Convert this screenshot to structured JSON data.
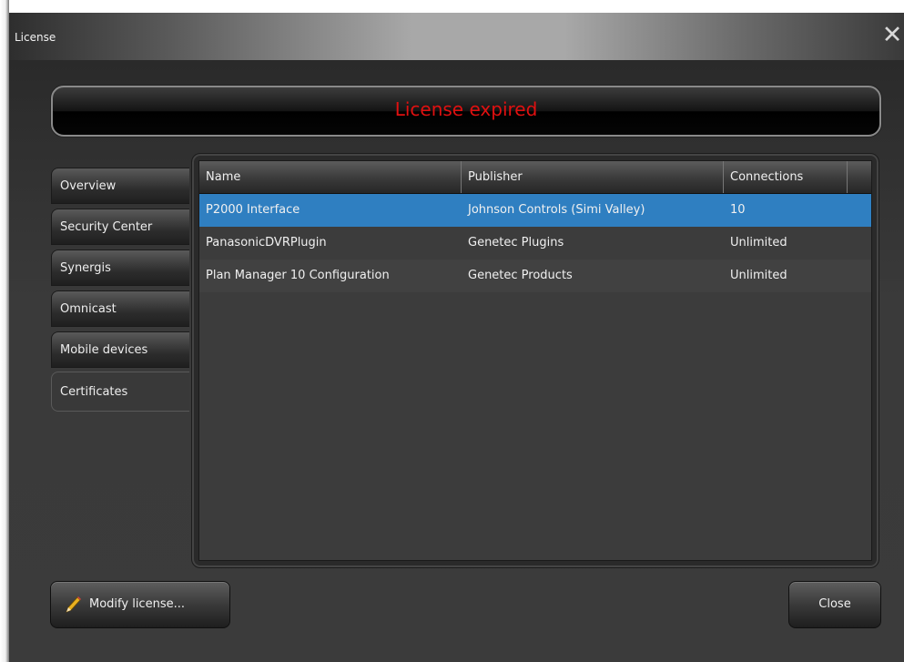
{
  "window": {
    "title": "License",
    "close_glyph": "✕"
  },
  "status": {
    "text": "License expired",
    "color": "#e01010"
  },
  "tabs": [
    {
      "label": "Overview"
    },
    {
      "label": "Security Center"
    },
    {
      "label": "Synergis"
    },
    {
      "label": "Omnicast"
    },
    {
      "label": "Mobile devices"
    },
    {
      "label": "Certificates",
      "active": true
    }
  ],
  "table": {
    "columns": [
      "Name",
      "Publisher",
      "Connections"
    ],
    "rows": [
      [
        "P2000 Interface",
        "Johnson Controls (Simi Valley)",
        "10"
      ],
      [
        "PanasonicDVRPlugin",
        "Genetec Plugins",
        "Unlimited"
      ],
      [
        "Plan Manager 10 Configuration",
        "Genetec Products",
        "Unlimited"
      ]
    ],
    "selected_row": 0,
    "selection_color": "#2f7fc1"
  },
  "footer": {
    "modify_label": "Modify license...",
    "modify_icon": "pencil-icon",
    "close_label": "Close"
  }
}
